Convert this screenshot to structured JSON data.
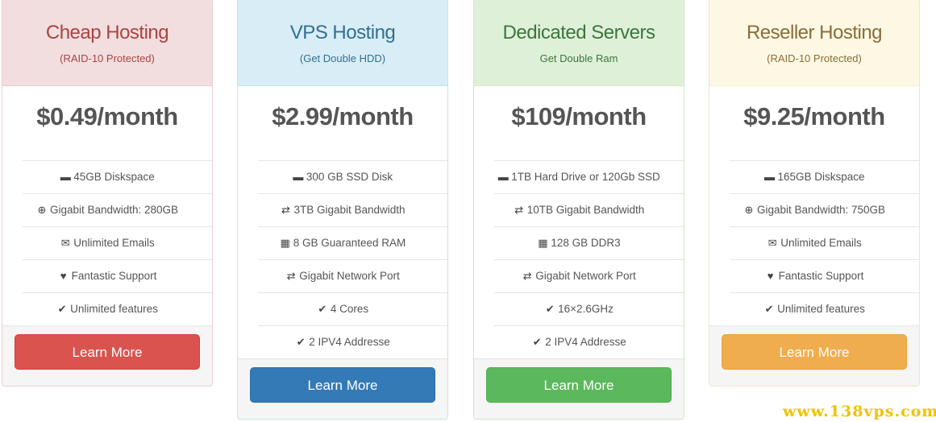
{
  "plans": [
    {
      "title": "Cheap Hosting",
      "subtitle": "(RAID-10 Protected)",
      "price": "$0.49/month",
      "features": [
        {
          "icon": "hdd-icon",
          "glyph": "▬",
          "text": "45GB Diskspace"
        },
        {
          "icon": "plus-circle-icon",
          "glyph": "⊕",
          "text": "Gigabit Bandwidth: 280GB"
        },
        {
          "icon": "envelope-icon",
          "glyph": "✉",
          "text": "Unlimited Emails"
        },
        {
          "icon": "heart-icon",
          "glyph": "♥",
          "text": "Fantastic Support"
        },
        {
          "icon": "check-icon",
          "glyph": "✔",
          "text": "Unlimited features"
        }
      ],
      "button": "Learn More",
      "accent": "#d9534f"
    },
    {
      "title": "VPS Hosting",
      "subtitle": "(Get Double HDD)",
      "price": "$2.99/month",
      "features": [
        {
          "icon": "hdd-icon",
          "glyph": "▬",
          "text": "300 GB SSD Disk"
        },
        {
          "icon": "transfer-icon",
          "glyph": "⇄",
          "text": "3TB Gigabit Bandwidth"
        },
        {
          "icon": "chip-icon",
          "glyph": "▦",
          "text": "8 GB Guaranteed RAM"
        },
        {
          "icon": "transfer-icon",
          "glyph": "⇄",
          "text": "Gigabit Network Port"
        },
        {
          "icon": "check-icon",
          "glyph": "✔",
          "text": "4 Cores"
        },
        {
          "icon": "check-icon",
          "glyph": "✔",
          "text": "2 IPV4 Addresse"
        }
      ],
      "button": "Learn More",
      "accent": "#337ab7"
    },
    {
      "title": "Dedicated Servers",
      "subtitle": "Get Double Ram",
      "price": "$109/month",
      "features": [
        {
          "icon": "hdd-icon",
          "glyph": "▬",
          "text": "1TB Hard Drive or 120Gb SSD"
        },
        {
          "icon": "transfer-icon",
          "glyph": "⇄",
          "text": "10TB Gigabit Bandwidth"
        },
        {
          "icon": "chip-icon",
          "glyph": "▦",
          "text": "128 GB DDR3"
        },
        {
          "icon": "transfer-icon",
          "glyph": "⇄",
          "text": "Gigabit Network Port"
        },
        {
          "icon": "check-icon",
          "glyph": "✔",
          "text": "16×2.6GHz"
        },
        {
          "icon": "check-icon",
          "glyph": "✔",
          "text": "2 IPV4 Addresse"
        }
      ],
      "button": "Learn More",
      "accent": "#5cb85c"
    },
    {
      "title": "Reseller Hosting",
      "subtitle": "(RAID-10 Protected)",
      "price": "$9.25/month",
      "features": [
        {
          "icon": "hdd-icon",
          "glyph": "▬",
          "text": "165GB Diskspace"
        },
        {
          "icon": "plus-circle-icon",
          "glyph": "⊕",
          "text": "Gigabit Bandwidth: 750GB"
        },
        {
          "icon": "envelope-icon",
          "glyph": "✉",
          "text": "Unlimited Emails"
        },
        {
          "icon": "heart-icon",
          "glyph": "♥",
          "text": "Fantastic Support"
        },
        {
          "icon": "check-icon",
          "glyph": "✔",
          "text": "Unlimited features"
        }
      ],
      "button": "Learn More",
      "accent": "#f0ad4e"
    }
  ],
  "watermark": "www.138vps.com"
}
